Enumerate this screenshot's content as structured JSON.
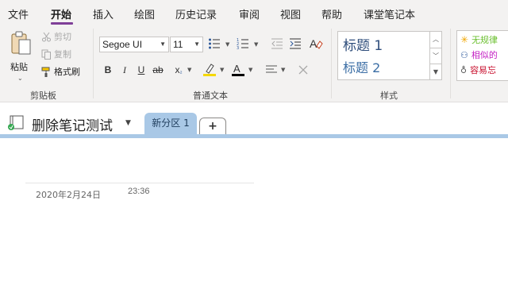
{
  "menu": {
    "tabs": [
      "文件",
      "开始",
      "插入",
      "绘图",
      "历史记录",
      "审阅",
      "视图",
      "帮助",
      "课堂笔记本"
    ],
    "active": "开始"
  },
  "clipboard": {
    "paste_label": "粘贴",
    "cut_label": "剪切",
    "copy_label": "复制",
    "format_painter_label": "格式刷",
    "group_label": "剪贴板"
  },
  "basic_text": {
    "font_name": "Segoe UI",
    "font_size": "11",
    "bold": "B",
    "italic": "I",
    "underline": "U",
    "strike": "ab",
    "subscript": "x",
    "group_label": "普通文本",
    "highlight_color": "#f5d800",
    "font_color": "#000000"
  },
  "styles": {
    "heading1": "标题 1",
    "heading2": "标题 2",
    "group_label": "样式"
  },
  "tags": {
    "items": [
      {
        "label": "无规律",
        "color": "#6abf2e"
      },
      {
        "label": "相似的",
        "color": "#c31fc3"
      },
      {
        "label": "容易忘",
        "color": "#c8102e"
      }
    ]
  },
  "notebook": {
    "name": "删除笔记测试",
    "section": "新分区 1",
    "add_section": "+",
    "section_color": "#a9c8e6"
  },
  "page": {
    "date": "2020年2月24日",
    "time": "23:36"
  }
}
